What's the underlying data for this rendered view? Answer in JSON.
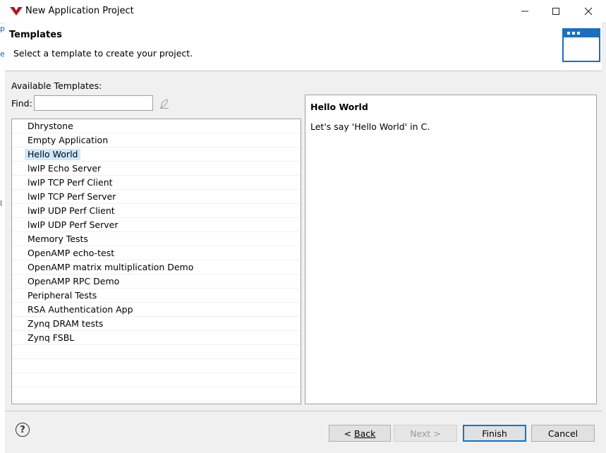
{
  "window": {
    "title": "New Application Project"
  },
  "header": {
    "title": "Templates",
    "description": "Select a template to create your project."
  },
  "templates": {
    "label": "Available Templates:",
    "find_label": "Find:",
    "find_value": "",
    "items": [
      "Dhrystone",
      "Empty Application",
      "Hello World",
      "lwIP Echo Server",
      "lwIP TCP Perf Client",
      "lwIP TCP Perf Server",
      "lwIP UDP Perf Client",
      "lwIP UDP Perf Server",
      "Memory Tests",
      "OpenAMP echo-test",
      "OpenAMP matrix multiplication Demo",
      "OpenAMP RPC Demo",
      "Peripheral Tests",
      "RSA Authentication App",
      "Zynq DRAM tests",
      "Zynq FSBL"
    ],
    "selected": "Hello World"
  },
  "detail": {
    "title": "Hello World",
    "description": "Let's say 'Hello World' in C."
  },
  "buttons": {
    "back_prefix": "< ",
    "back": "Back",
    "next": "Next >",
    "finish": "Finish",
    "cancel": "Cancel"
  },
  "colors": {
    "selection": "#cce8ff",
    "default_button_border": "#0078d7",
    "logo": "#c0202a"
  }
}
